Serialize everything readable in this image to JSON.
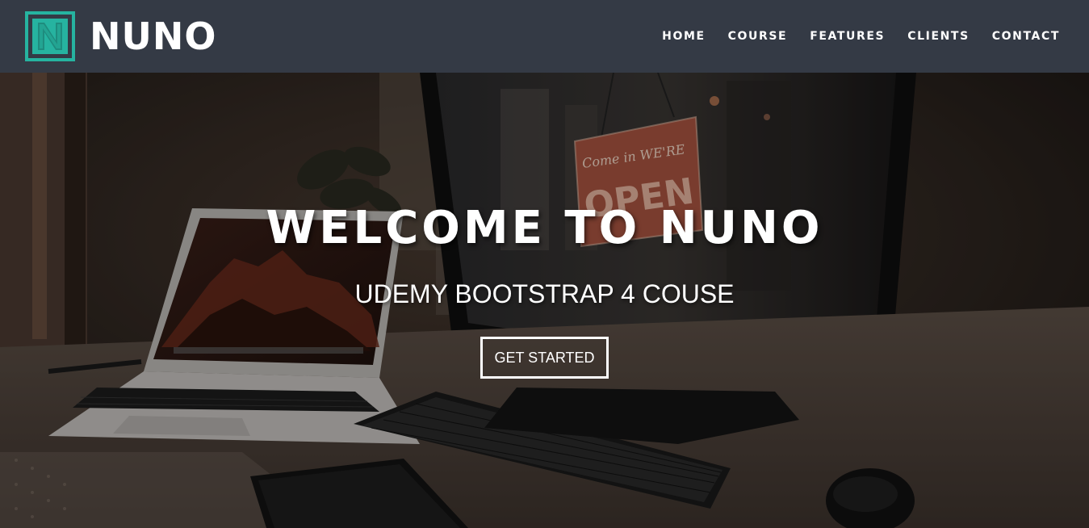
{
  "brand": {
    "logo_icon": "n-letter-logo-icon",
    "logo_letter": "N",
    "name": "NUNO",
    "accent_color": "#26b3a0"
  },
  "nav": {
    "background_color": "#343a45",
    "items": [
      {
        "label": "HOME"
      },
      {
        "label": "COURSE"
      },
      {
        "label": "FEATURES"
      },
      {
        "label": "CLIENTS"
      },
      {
        "label": "CONTACT"
      }
    ]
  },
  "hero": {
    "title": "WELCOME TO NUNO",
    "subtitle": "UDEMY BOOTSTRAP 4 COUSE",
    "button_label": "GET STARTED",
    "sign_text_small": "Come in WE'RE",
    "sign_text_large": "OPEN"
  }
}
